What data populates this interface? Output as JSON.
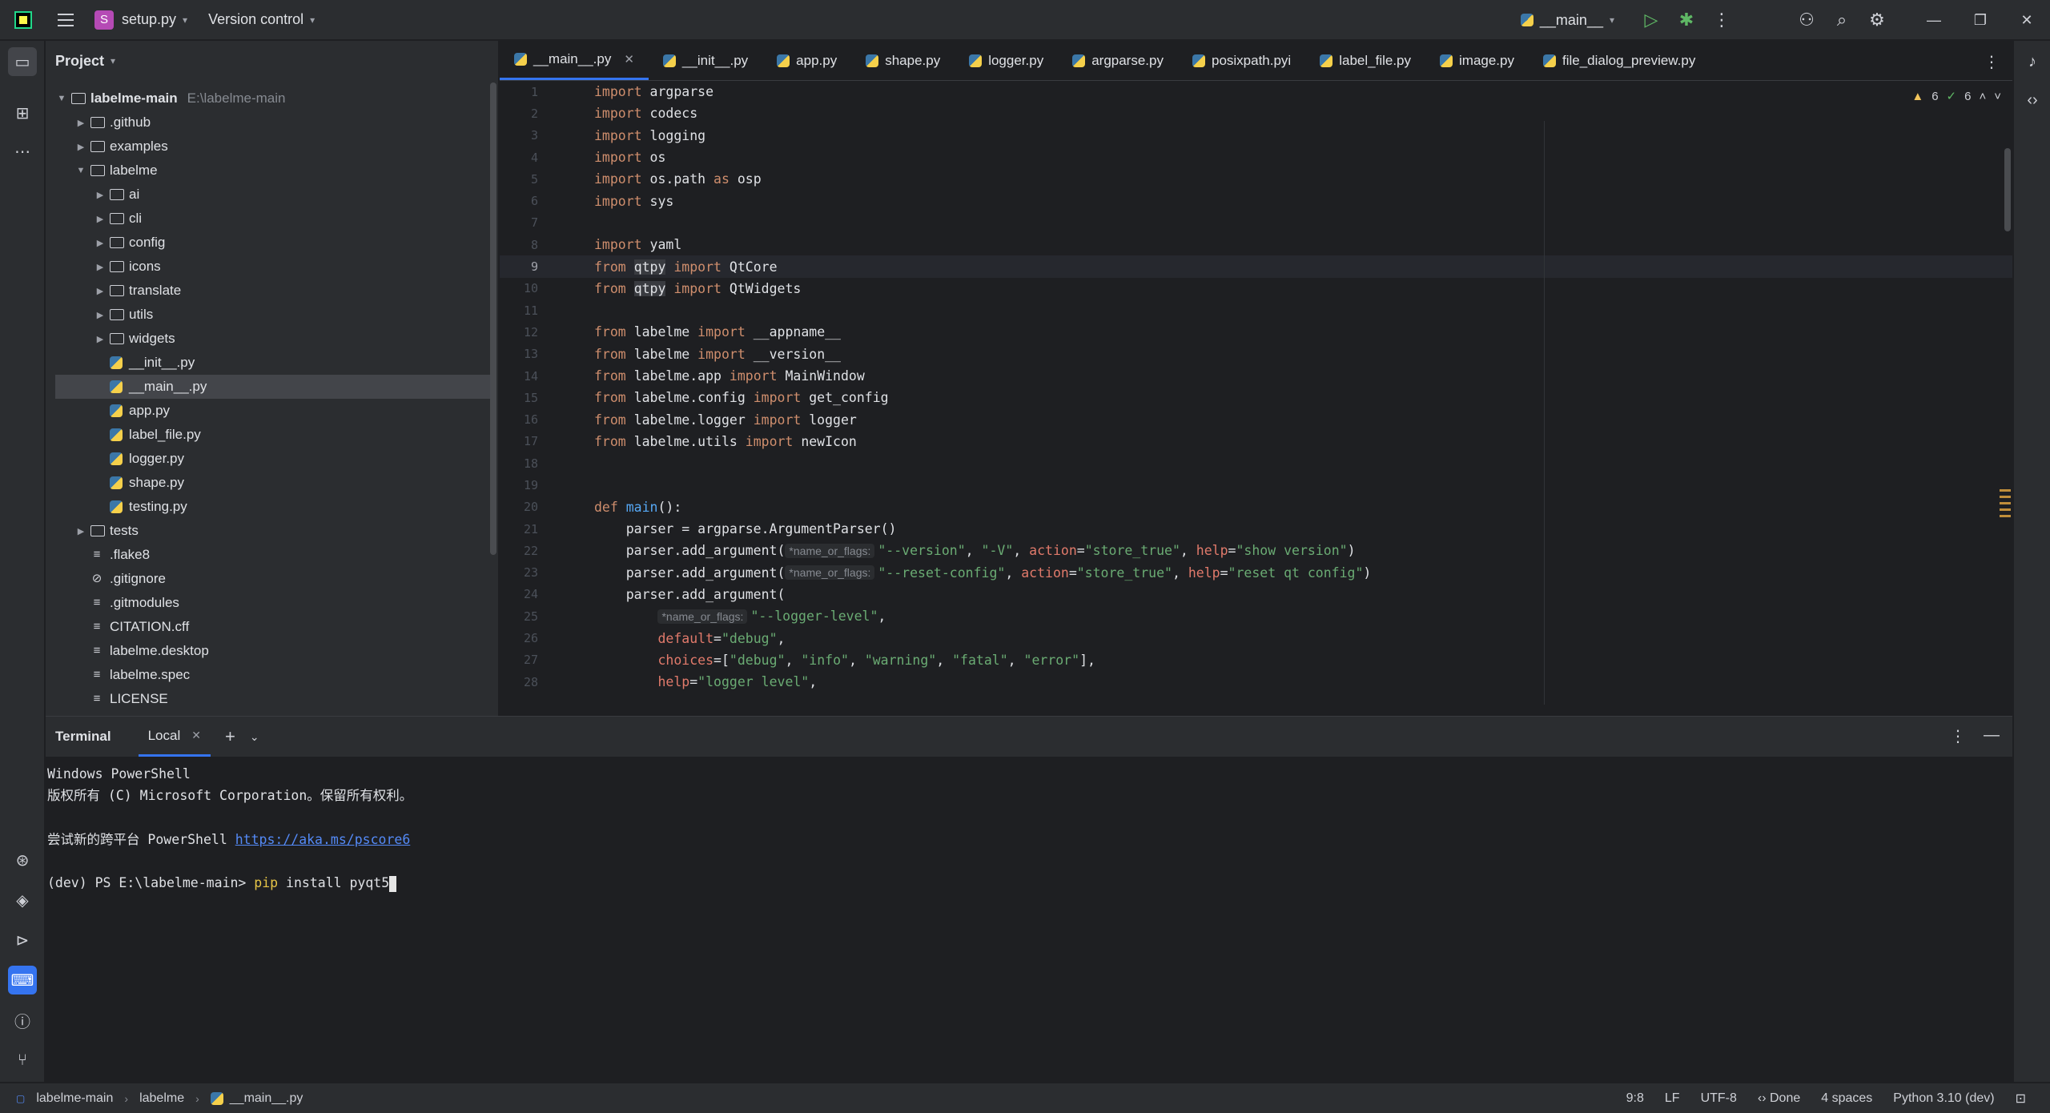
{
  "titlebar": {
    "project_badge": "S",
    "project_name": "setup.py",
    "version_control": "Version control",
    "run_config": "__main__"
  },
  "project_panel": {
    "title": "Project",
    "root_name": "labelme-main",
    "root_path": "E:\\labelme-main",
    "items": [
      {
        "label": ".github",
        "type": "folder",
        "depth": 1,
        "state": "collapsed"
      },
      {
        "label": "examples",
        "type": "folder",
        "depth": 1,
        "state": "collapsed"
      },
      {
        "label": "labelme",
        "type": "folder",
        "depth": 1,
        "state": "expanded"
      },
      {
        "label": "ai",
        "type": "folder",
        "depth": 2,
        "state": "collapsed"
      },
      {
        "label": "cli",
        "type": "folder",
        "depth": 2,
        "state": "collapsed"
      },
      {
        "label": "config",
        "type": "folder",
        "depth": 2,
        "state": "collapsed"
      },
      {
        "label": "icons",
        "type": "folder",
        "depth": 2,
        "state": "collapsed"
      },
      {
        "label": "translate",
        "type": "folder",
        "depth": 2,
        "state": "collapsed"
      },
      {
        "label": "utils",
        "type": "folder",
        "depth": 2,
        "state": "collapsed"
      },
      {
        "label": "widgets",
        "type": "folder",
        "depth": 2,
        "state": "collapsed"
      },
      {
        "label": "__init__.py",
        "type": "python",
        "depth": 2
      },
      {
        "label": "__main__.py",
        "type": "python",
        "depth": 2,
        "selected": true
      },
      {
        "label": "app.py",
        "type": "python",
        "depth": 2
      },
      {
        "label": "label_file.py",
        "type": "python",
        "depth": 2
      },
      {
        "label": "logger.py",
        "type": "python",
        "depth": 2
      },
      {
        "label": "shape.py",
        "type": "python",
        "depth": 2
      },
      {
        "label": "testing.py",
        "type": "python",
        "depth": 2
      },
      {
        "label": "tests",
        "type": "folder",
        "depth": 1,
        "state": "collapsed"
      },
      {
        "label": ".flake8",
        "type": "text",
        "depth": 1
      },
      {
        "label": ".gitignore",
        "type": "ignore",
        "depth": 1
      },
      {
        "label": ".gitmodules",
        "type": "text",
        "depth": 1
      },
      {
        "label": "CITATION.cff",
        "type": "text",
        "depth": 1
      },
      {
        "label": "labelme.desktop",
        "type": "text",
        "depth": 1
      },
      {
        "label": "labelme.spec",
        "type": "text",
        "depth": 1
      },
      {
        "label": "LICENSE",
        "type": "text",
        "depth": 1
      }
    ]
  },
  "editor": {
    "tabs": [
      {
        "label": "__main__.py",
        "active": true,
        "closable": true
      },
      {
        "label": "__init__.py"
      },
      {
        "label": "app.py"
      },
      {
        "label": "shape.py"
      },
      {
        "label": "logger.py"
      },
      {
        "label": "argparse.py"
      },
      {
        "label": "posixpath.pyi"
      },
      {
        "label": "label_file.py"
      },
      {
        "label": "image.py"
      },
      {
        "label": "file_dialog_preview.py"
      }
    ],
    "inspections": {
      "warnings": "6",
      "ok": "6"
    },
    "current_line": 9,
    "lines": [
      {
        "n": "1",
        "tokens": [
          [
            "kw",
            "import"
          ],
          [
            "",
            "argparse"
          ]
        ]
      },
      {
        "n": "2",
        "tokens": [
          [
            "kw",
            "import"
          ],
          [
            "",
            "codecs"
          ]
        ]
      },
      {
        "n": "3",
        "tokens": [
          [
            "kw",
            "import"
          ],
          [
            "",
            "logging"
          ]
        ]
      },
      {
        "n": "4",
        "tokens": [
          [
            "kw",
            "import"
          ],
          [
            "",
            "os"
          ]
        ]
      },
      {
        "n": "5",
        "tokens": [
          [
            "kw",
            "import"
          ],
          [
            "",
            "os.path "
          ],
          [
            "kw",
            "as"
          ],
          [
            "",
            "osp"
          ]
        ]
      },
      {
        "n": "6",
        "tokens": [
          [
            "kw",
            "import"
          ],
          [
            "",
            "sys"
          ]
        ]
      },
      {
        "n": "7",
        "tokens": []
      },
      {
        "n": "8",
        "tokens": [
          [
            "kw",
            "import"
          ],
          [
            "",
            "yaml"
          ]
        ]
      },
      {
        "n": "9",
        "tokens": [
          [
            "kw",
            "from"
          ],
          [
            "hl",
            "qtpy"
          ],
          [
            "kw",
            " import"
          ],
          [
            "",
            "QtCore"
          ]
        ]
      },
      {
        "n": "10",
        "tokens": [
          [
            "kw",
            "from"
          ],
          [
            "hl",
            "qtpy"
          ],
          [
            "kw",
            " import"
          ],
          [
            "",
            "QtWidgets"
          ]
        ]
      },
      {
        "n": "11",
        "tokens": []
      },
      {
        "n": "12",
        "tokens": [
          [
            "kw",
            "from"
          ],
          [
            "",
            "labelme "
          ],
          [
            "kw",
            "import"
          ],
          [
            "",
            "__appname__"
          ]
        ]
      },
      {
        "n": "13",
        "tokens": [
          [
            "kw",
            "from"
          ],
          [
            "",
            "labelme "
          ],
          [
            "kw",
            "import"
          ],
          [
            "",
            "__version__"
          ]
        ]
      },
      {
        "n": "14",
        "tokens": [
          [
            "kw",
            "from"
          ],
          [
            "",
            "labelme.app "
          ],
          [
            "kw",
            "import"
          ],
          [
            "",
            "MainWindow"
          ]
        ]
      },
      {
        "n": "15",
        "tokens": [
          [
            "kw",
            "from"
          ],
          [
            "",
            "labelme.config "
          ],
          [
            "kw",
            "import"
          ],
          [
            "",
            "get_config"
          ]
        ]
      },
      {
        "n": "16",
        "tokens": [
          [
            "kw",
            "from"
          ],
          [
            "",
            "labelme.logger "
          ],
          [
            "kw",
            "import"
          ],
          [
            "",
            "logger"
          ]
        ]
      },
      {
        "n": "17",
        "tokens": [
          [
            "kw",
            "from"
          ],
          [
            "",
            "labelme.utils "
          ],
          [
            "kw",
            "import"
          ],
          [
            "",
            "newIcon"
          ]
        ]
      },
      {
        "n": "18",
        "tokens": []
      },
      {
        "n": "19",
        "tokens": []
      },
      {
        "n": "20",
        "tokens": [
          [
            "kw",
            "def"
          ],
          [
            "fn",
            "main"
          ],
          [
            "",
            "():"
          ]
        ]
      },
      {
        "n": "21",
        "tokens": [
          [
            "",
            "    parser = argparse.ArgumentParser()"
          ]
        ]
      },
      {
        "n": "22",
        "tokens": [
          [
            "",
            "    parser.add_argument("
          ],
          [
            "hint",
            "*name_or_flags:"
          ],
          [
            "str",
            "\"--version\""
          ],
          [
            "",
            ", "
          ],
          [
            "str",
            "\"-V\""
          ],
          [
            "",
            ", "
          ],
          [
            "param",
            "action"
          ],
          [
            "",
            "="
          ],
          [
            "str",
            "\"store_true\""
          ],
          [
            "",
            ", "
          ],
          [
            "param",
            "help"
          ],
          [
            "",
            "="
          ],
          [
            "str",
            "\"show version\""
          ],
          [
            "",
            ")"
          ]
        ]
      },
      {
        "n": "23",
        "tokens": [
          [
            "",
            "    parser.add_argument("
          ],
          [
            "hint",
            "*name_or_flags:"
          ],
          [
            "str",
            "\"--reset-config\""
          ],
          [
            "",
            ", "
          ],
          [
            "param",
            "action"
          ],
          [
            "",
            "="
          ],
          [
            "str",
            "\"store_true\""
          ],
          [
            "",
            ", "
          ],
          [
            "param",
            "help"
          ],
          [
            "",
            "="
          ],
          [
            "str",
            "\"reset qt config\""
          ],
          [
            "",
            ")"
          ]
        ]
      },
      {
        "n": "24",
        "tokens": [
          [
            "",
            "    parser.add_argument("
          ]
        ]
      },
      {
        "n": "25",
        "tokens": [
          [
            "",
            "        "
          ],
          [
            "hint",
            "*name_or_flags:"
          ],
          [
            "str",
            "\"--logger-level\""
          ],
          [
            "",
            ","
          ]
        ]
      },
      {
        "n": "26",
        "tokens": [
          [
            "",
            "        "
          ],
          [
            "param",
            "default"
          ],
          [
            "",
            "="
          ],
          [
            "str",
            "\"debug\""
          ],
          [
            "",
            ","
          ]
        ]
      },
      {
        "n": "27",
        "tokens": [
          [
            "",
            "        "
          ],
          [
            "param",
            "choices"
          ],
          [
            "",
            "=["
          ],
          [
            "str",
            "\"debug\""
          ],
          [
            "",
            ", "
          ],
          [
            "str",
            "\"info\""
          ],
          [
            "",
            ", "
          ],
          [
            "str",
            "\"warning\""
          ],
          [
            "",
            ", "
          ],
          [
            "str",
            "\"fatal\""
          ],
          [
            "",
            ", "
          ],
          [
            "str",
            "\"error\""
          ],
          [
            "",
            "],"
          ]
        ]
      },
      {
        "n": "28",
        "tokens": [
          [
            "",
            "        "
          ],
          [
            "param",
            "help"
          ],
          [
            "",
            "="
          ],
          [
            "str",
            "\"logger level\""
          ],
          [
            "",
            ","
          ]
        ]
      }
    ]
  },
  "terminal": {
    "title": "Terminal",
    "tab_label": "Local",
    "lines": [
      "Windows PowerShell",
      "版权所有 (C) Microsoft Corporation。保留所有权利。",
      "",
      "尝试新的跨平台 PowerShell ",
      "",
      "(dev) PS E:\\labelme-main> "
    ],
    "link": "https://aka.ms/pscore6",
    "command_program": "pip",
    "command_args": " install pyqt5"
  },
  "statusbar": {
    "breadcrumb": [
      "labelme-main",
      "labelme",
      "__main__.py"
    ],
    "position": "9:8",
    "line_sep": "LF",
    "encoding": "UTF-8",
    "code_status": "Done",
    "indent": "4 spaces",
    "interpreter": "Python 3.10 (dev)"
  }
}
